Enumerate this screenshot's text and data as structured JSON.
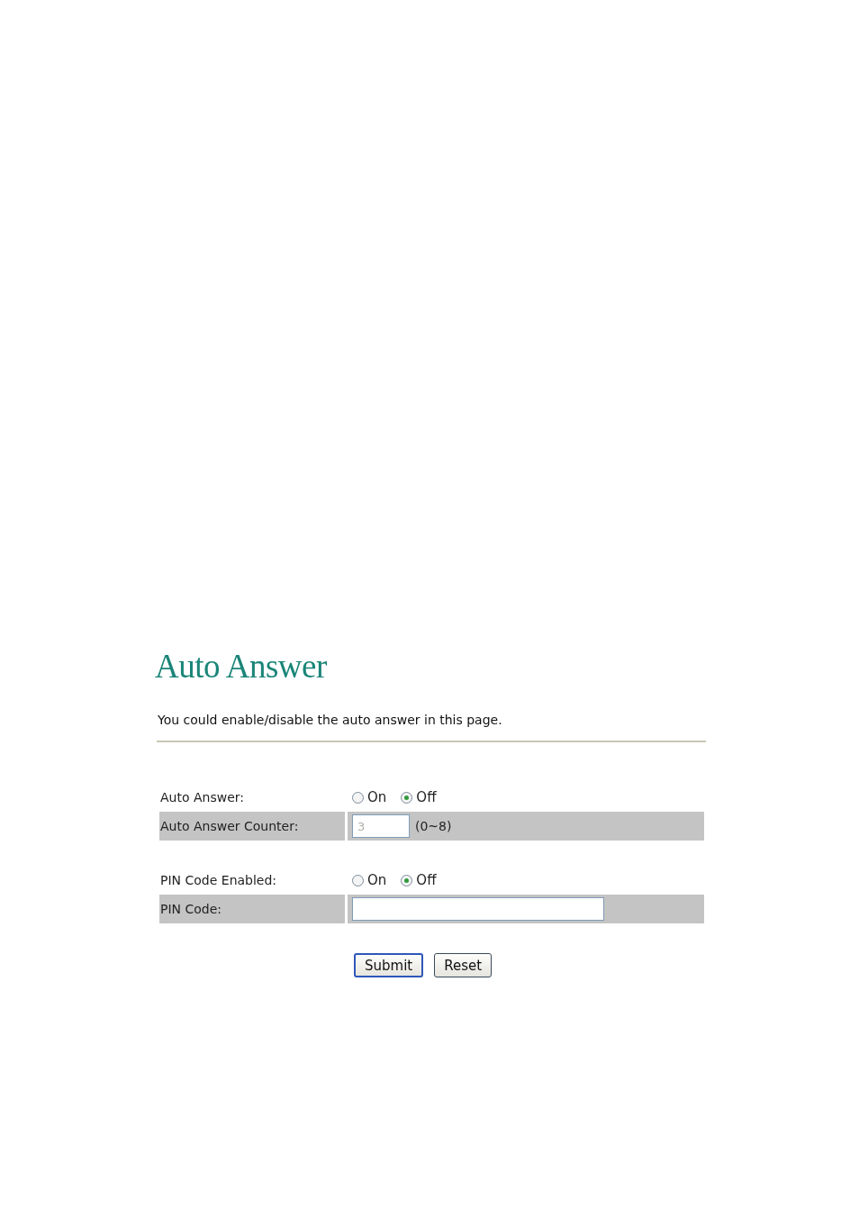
{
  "title": "Auto Answer",
  "description": "You could enable/disable the auto answer in this page.",
  "sections": [
    {
      "rows": [
        {
          "kind": "radio",
          "shaded": false,
          "label": "Auto Answer:",
          "options": [
            {
              "label": "On",
              "selected": false
            },
            {
              "label": "Off",
              "selected": true
            }
          ]
        },
        {
          "kind": "text",
          "shaded": true,
          "label": "Auto Answer Counter:",
          "value": "3",
          "disabled": true,
          "wide": false,
          "hint": "(0~8)"
        }
      ]
    },
    {
      "rows": [
        {
          "kind": "radio",
          "shaded": false,
          "label": "PIN Code Enabled:",
          "options": [
            {
              "label": "On",
              "selected": false
            },
            {
              "label": "Off",
              "selected": true
            }
          ]
        },
        {
          "kind": "text",
          "shaded": true,
          "label": "PIN Code:",
          "value": "",
          "disabled": false,
          "wide": true
        }
      ]
    }
  ],
  "buttons": [
    {
      "label": "Submit",
      "default": true
    },
    {
      "label": "Reset",
      "default": false
    }
  ]
}
